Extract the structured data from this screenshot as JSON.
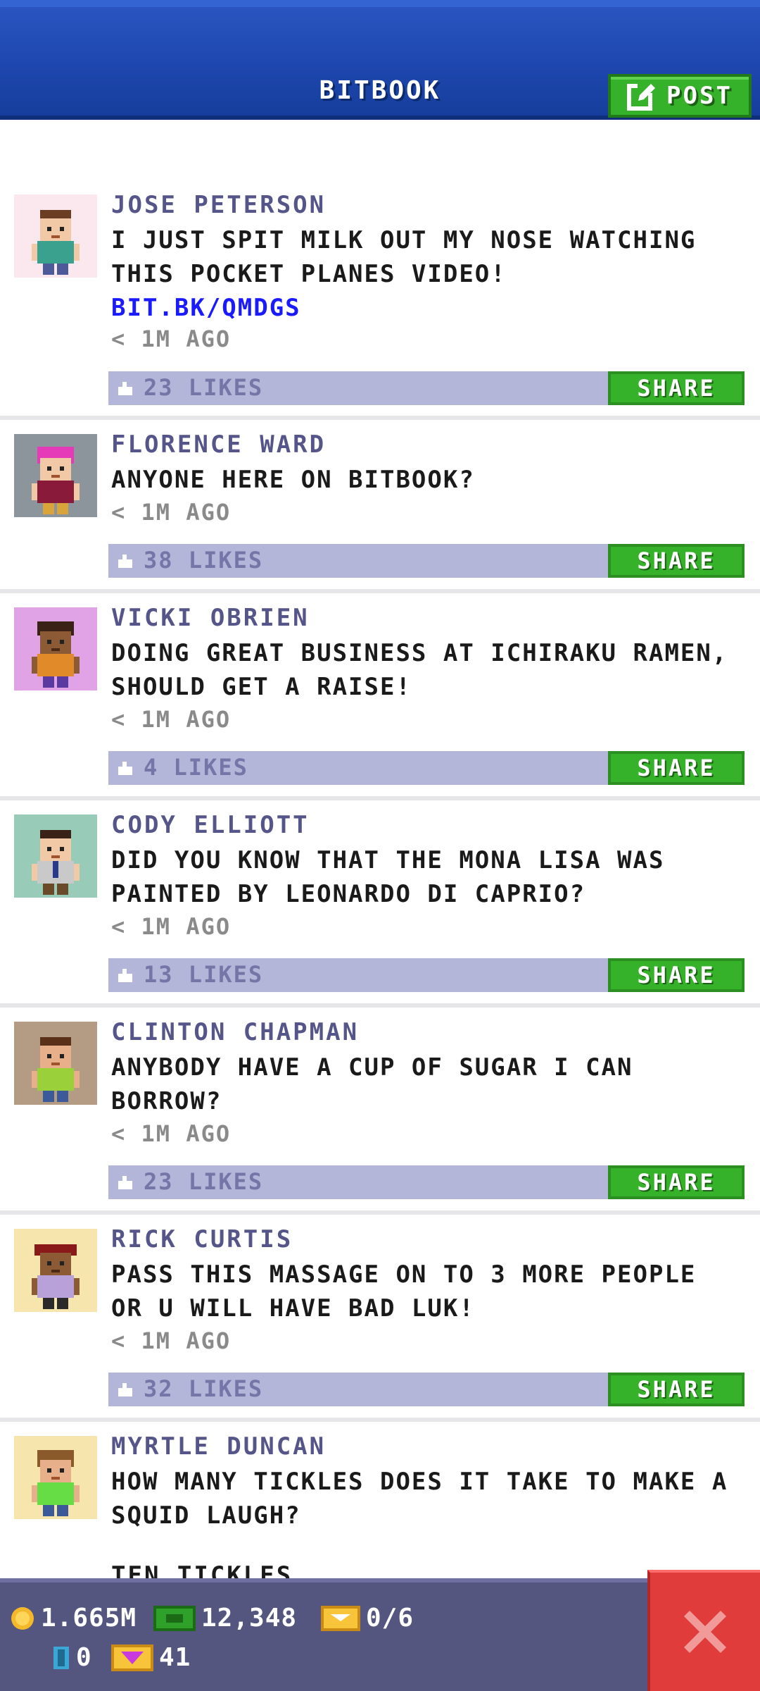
{
  "header": {
    "title": "BITBOOK",
    "post_label": "POST"
  },
  "posts": [
    {
      "name": "JOSE PETERSON",
      "line1": "I JUST SPIT MILK OUT MY NOSE WATCHING",
      "line2": "THIS POCKET PLANES VIDEO!",
      "link": "BIT.BK/QMDGS",
      "time": "< 1M AGO",
      "likes": "23 LIKES",
      "share": "SHARE",
      "avatar_bg": "#fbe8ef"
    },
    {
      "name": "FLORENCE WARD",
      "line1": "ANYONE HERE ON BITBOOK?",
      "line2": "",
      "time": "< 1M AGO",
      "likes": "38 LIKES",
      "share": "SHARE",
      "avatar_bg": "#8d959c"
    },
    {
      "name": "VICKI OBRIEN",
      "line1": "DOING GREAT BUSINESS AT ICHIRAKU RAMEN,",
      "line2": "SHOULD GET A RAISE!",
      "time": "< 1M AGO",
      "likes": "4 LIKES",
      "share": "SHARE",
      "avatar_bg": "#e0a4e6"
    },
    {
      "name": "CODY ELLIOTT",
      "line1": "DID YOU KNOW THAT THE MONA LISA WAS",
      "line2": "PAINTED BY LEONARDO DI CAPRIO?",
      "time": "< 1M AGO",
      "likes": "13 LIKES",
      "share": "SHARE",
      "avatar_bg": "#98ccb8"
    },
    {
      "name": "CLINTON CHAPMAN",
      "line1": "ANYBODY HAVE A CUP OF SUGAR I CAN",
      "line2": "BORROW?",
      "time": "< 1M AGO",
      "likes": "23 LIKES",
      "share": "SHARE",
      "avatar_bg": "#b49c84"
    },
    {
      "name": "RICK CURTIS",
      "line1": "PASS THIS MASSAGE ON TO 3 MORE PEOPLE",
      "line2": "OR U WILL HAVE BAD LUK!",
      "time": "< 1M AGO",
      "likes": "32 LIKES",
      "share": "SHARE",
      "avatar_bg": "#f6e6ae"
    },
    {
      "name": "MYRTLE DUNCAN",
      "line1": "HOW MANY TICKLES DOES IT TAKE TO MAKE A",
      "line2": "SQUID LAUGH?",
      "partial": "TEN TICKLES",
      "avatar_bg": "#f6e6ae"
    }
  ],
  "status": {
    "coins": "1.665M",
    "bux": "12,348",
    "tickets": "0/6",
    "elevator": "0",
    "gems": "41"
  },
  "colors": {
    "header_blue": "#1f48b0",
    "share_green": "#36b12a",
    "likes_bar": "#b3b6d9",
    "close_red": "#e03c3c"
  }
}
